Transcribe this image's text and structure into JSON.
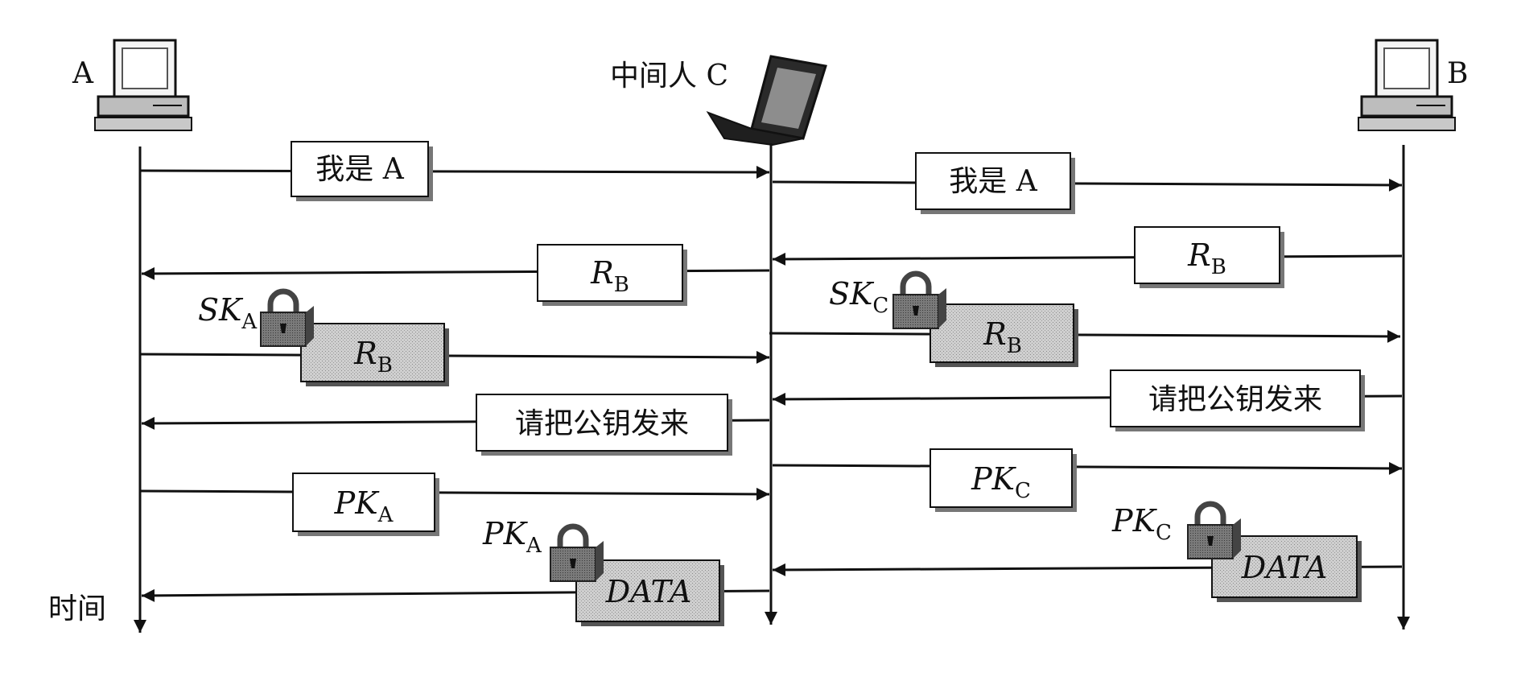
{
  "participants": {
    "a": "A",
    "b": "B",
    "c": "中间人 C"
  },
  "time_label": "时间",
  "messages": [
    {
      "id": "m1",
      "text": "我是 A"
    },
    {
      "id": "m2",
      "text": "我是 A"
    },
    {
      "id": "m3",
      "main": "R",
      "sub": "B"
    },
    {
      "id": "m4",
      "main": "R",
      "sub": "B"
    },
    {
      "id": "m5",
      "main": "R",
      "sub": "B",
      "key_main": "SK",
      "key_sub": "A"
    },
    {
      "id": "m6",
      "main": "R",
      "sub": "B",
      "key_main": "SK",
      "key_sub": "C"
    },
    {
      "id": "m7",
      "text": "请把公钥发来"
    },
    {
      "id": "m8",
      "text": "请把公钥发来"
    },
    {
      "id": "m9",
      "main": "PK",
      "sub": "A"
    },
    {
      "id": "m10",
      "main": "PK",
      "sub": "C"
    },
    {
      "id": "m11",
      "text": "DATA",
      "key_main": "PK",
      "key_sub": "A"
    },
    {
      "id": "m12",
      "text": "DATA",
      "key_main": "PK",
      "key_sub": "C"
    }
  ]
}
